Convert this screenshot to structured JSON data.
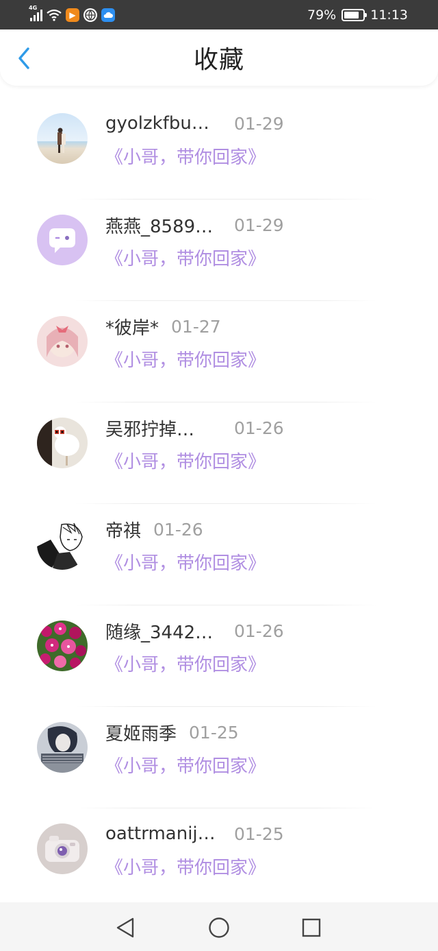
{
  "status_bar": {
    "network": "4G",
    "battery": "79%",
    "battery_level": 0.79,
    "time": "11:13"
  },
  "header": {
    "title": "收藏"
  },
  "items": [
    {
      "name": "gyolzkfbu…",
      "date": "01-29",
      "subtitle": "《小哥，带你回家》"
    },
    {
      "name": "燕燕_8589…",
      "date": "01-29",
      "subtitle": "《小哥，带你回家》"
    },
    {
      "name": "*彼岸*",
      "date": "01-27",
      "subtitle": "《小哥，带你回家》"
    },
    {
      "name": "吴邪拧掉…",
      "date": "01-26",
      "subtitle": "《小哥，带你回家》"
    },
    {
      "name": "帝祺",
      "date": "01-26",
      "subtitle": "《小哥，带你回家》"
    },
    {
      "name": "随缘_3442…",
      "date": "01-26",
      "subtitle": "《小哥，带你回家》"
    },
    {
      "name": "夏姬雨季",
      "date": "01-25",
      "subtitle": "《小哥，带你回家》"
    },
    {
      "name": "oattrmanij…",
      "date": "01-25",
      "subtitle": "《小哥，带你回家》"
    }
  ],
  "colors": {
    "accent_purple": "#b08ee2",
    "back_blue": "#2f9be8",
    "status_bg": "#3b3b3b"
  }
}
